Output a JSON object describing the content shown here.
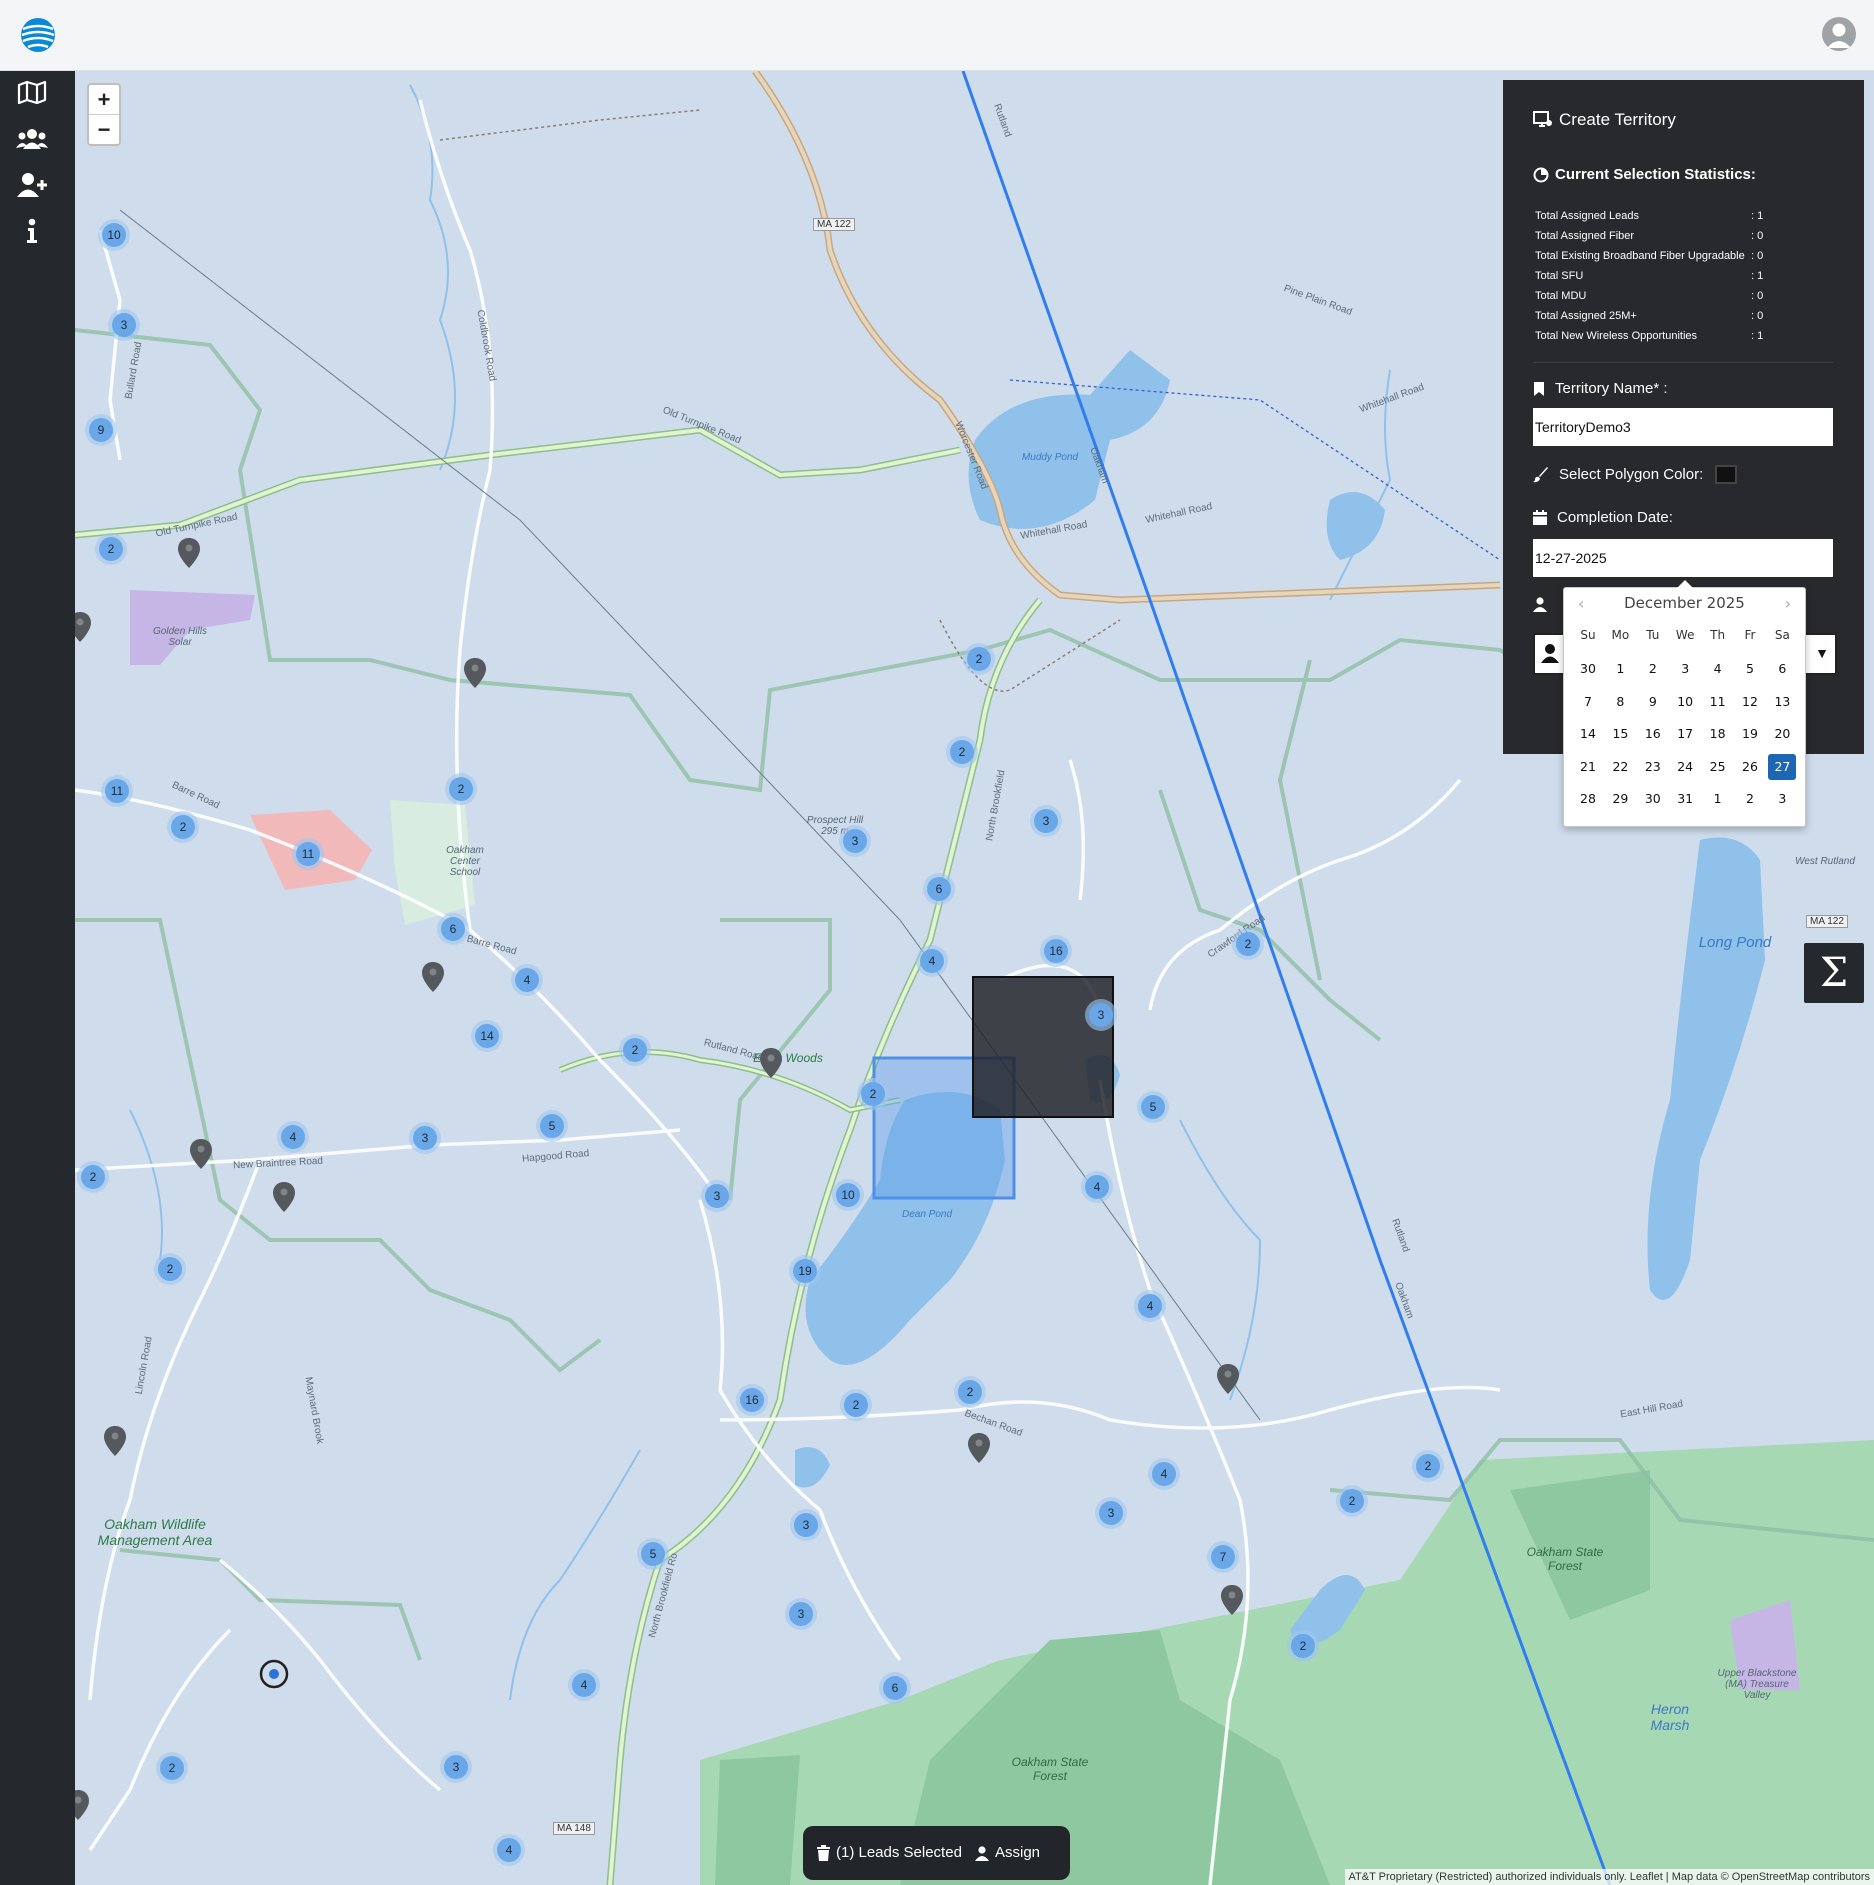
{
  "sidebar": {
    "items": [
      {
        "name": "map-icon"
      },
      {
        "name": "users-icon"
      },
      {
        "name": "user-plus-icon"
      },
      {
        "name": "info-icon"
      }
    ]
  },
  "map": {
    "zoom_in": "+",
    "zoom_out": "−",
    "place_labels": [
      {
        "text": "Oakham Wildlife Management Area"
      },
      {
        "text": "Oakham State Forest"
      },
      {
        "text": "Oakham State Forest"
      },
      {
        "text": "Long Pond"
      },
      {
        "text": "Eva's Woods"
      },
      {
        "text": "Dean Pond"
      },
      {
        "text": "Muddy Pond"
      },
      {
        "text": "Golden Hills Solar"
      },
      {
        "text": "Oakham Center School"
      },
      {
        "text": "Prospect Hill 295 m"
      },
      {
        "text": "Heron Marsh"
      },
      {
        "text": "Upper Blackstone (MA) Treasure Valley"
      },
      {
        "text": "West Rutland"
      }
    ],
    "road_labels": [
      {
        "text": "Old Turnpike Road"
      },
      {
        "text": "Old Turnpike Road"
      },
      {
        "text": "Worcester Road"
      },
      {
        "text": "Whitehall Road"
      },
      {
        "text": "Whitehall Road"
      },
      {
        "text": "Whitehall Road"
      },
      {
        "text": "Pine Plain Road"
      },
      {
        "text": "North Brookfield"
      },
      {
        "text": "Barre Road"
      },
      {
        "text": "Barre Road"
      },
      {
        "text": "Rutland Road"
      },
      {
        "text": "New Braintree Road"
      },
      {
        "text": "Hapgood Road"
      },
      {
        "text": "Bechan Road"
      },
      {
        "text": "East Hill Road"
      },
      {
        "text": "Crawford Road"
      },
      {
        "text": "Lincoln Road"
      },
      {
        "text": "Maynard Brook"
      },
      {
        "text": "North Brookfield Ro"
      },
      {
        "text": "MA 122"
      },
      {
        "text": "MA 122"
      },
      {
        "text": "MA 148"
      },
      {
        "text": "Coldbrook Road"
      },
      {
        "text": "Bullard Road"
      },
      {
        "text": "Rutland"
      },
      {
        "text": "Rutland"
      },
      {
        "text": "Oakham"
      },
      {
        "text": "Oakham"
      }
    ],
    "clusters": [
      {
        "count": "10"
      },
      {
        "count": "3"
      },
      {
        "count": "9"
      },
      {
        "count": "2"
      },
      {
        "count": "11"
      },
      {
        "count": "2"
      },
      {
        "count": "11"
      },
      {
        "count": "2"
      },
      {
        "count": "6"
      },
      {
        "count": "4"
      },
      {
        "count": "14"
      },
      {
        "count": "2"
      },
      {
        "count": "5"
      },
      {
        "count": "3"
      },
      {
        "count": "4"
      },
      {
        "count": "2"
      },
      {
        "count": "2"
      },
      {
        "count": "3"
      },
      {
        "count": "2"
      },
      {
        "count": "2"
      },
      {
        "count": "3"
      },
      {
        "count": "6"
      },
      {
        "count": "4"
      },
      {
        "count": "3"
      },
      {
        "count": "16"
      },
      {
        "count": "2"
      },
      {
        "count": "3"
      },
      {
        "count": "5"
      },
      {
        "count": "2"
      },
      {
        "count": "10"
      },
      {
        "count": "19"
      },
      {
        "count": "4"
      },
      {
        "count": "4"
      },
      {
        "count": "16"
      },
      {
        "count": "2"
      },
      {
        "count": "2"
      },
      {
        "count": "4"
      },
      {
        "count": "3"
      },
      {
        "count": "7"
      },
      {
        "count": "2"
      },
      {
        "count": "2"
      },
      {
        "count": "3"
      },
      {
        "count": "5"
      },
      {
        "count": "3"
      },
      {
        "count": "6"
      },
      {
        "count": "4"
      },
      {
        "count": "3"
      },
      {
        "count": "2"
      },
      {
        "count": "4"
      },
      {
        "count": "2"
      }
    ]
  },
  "panel": {
    "title": "Create Territory",
    "stats_title": "Current Selection Statistics:",
    "stats": [
      {
        "label": "Total Assigned Leads",
        "value": ": 1"
      },
      {
        "label": "Total Assigned Fiber",
        "value": ": 0"
      },
      {
        "label": "Total Existing Broadband Fiber Upgradable",
        "value": ": 0"
      },
      {
        "label": "Total SFU",
        "value": ": 1"
      },
      {
        "label": "Total MDU",
        "value": ": 0"
      },
      {
        "label": "Total Assigned 25M+",
        "value": ": 0"
      },
      {
        "label": "Total New Wireless Opportunities",
        "value": ": 1"
      }
    ],
    "territory_name_label": "Territory Name* :",
    "territory_name_value": "TerritoryDemo3",
    "polygon_color_label": "Select Polygon Color:",
    "polygon_color": "#111111",
    "completion_date_label": "Completion Date:",
    "completion_date_value": "12-27-2025"
  },
  "calendar": {
    "month": "December 2025",
    "prev": "‹",
    "next": "›",
    "weekdays": [
      "Su",
      "Mo",
      "Tu",
      "We",
      "Th",
      "Fr",
      "Sa"
    ],
    "weeks": [
      [
        "30",
        "1",
        "2",
        "3",
        "4",
        "5",
        "6"
      ],
      [
        "7",
        "8",
        "9",
        "10",
        "11",
        "12",
        "13"
      ],
      [
        "14",
        "15",
        "16",
        "17",
        "18",
        "19",
        "20"
      ],
      [
        "21",
        "22",
        "23",
        "24",
        "25",
        "26",
        "27"
      ],
      [
        "28",
        "29",
        "30",
        "31",
        "1",
        "2",
        "3"
      ]
    ],
    "selected": "27",
    "selected_color": "#1c66b2"
  },
  "sigma_label": "Σ",
  "bottom_bar": {
    "leads_selected": "(1) Leads Selected",
    "assign": "Assign"
  },
  "attribution": "AT&T Proprietary (Restricted) authorized individuals only. Leaflet | Map data © OpenStreetMap contributors",
  "colors": {
    "sidebar": "#25292d",
    "panel": "#27292c",
    "map_water": "#8fc1ea",
    "cluster": "#6aa7e8",
    "route_line": "#2f7df0"
  }
}
